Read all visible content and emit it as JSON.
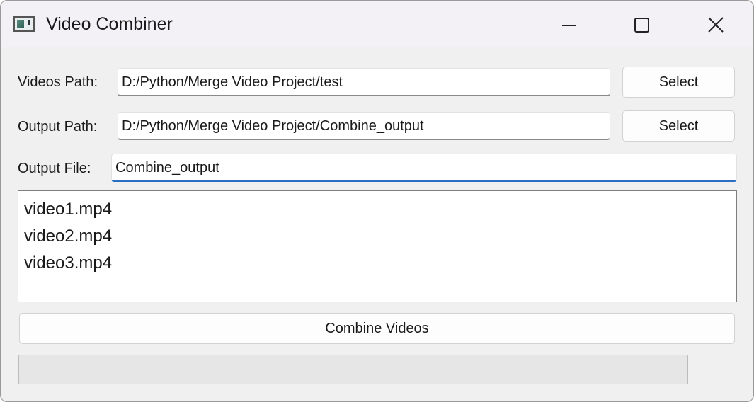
{
  "window": {
    "title": "Video Combiner",
    "app_icon": "app-window-icon",
    "controls": [
      "minimize-icon",
      "maximize-icon",
      "close-icon"
    ]
  },
  "form": {
    "videos_path_label": "Videos Path:",
    "videos_path_value": "D:/Python/Merge Video Project/test",
    "videos_select_label": "Select",
    "output_path_label": "Output Path:",
    "output_path_value": "D:/Python/Merge Video Project/Combine_output",
    "output_select_label": "Select",
    "output_file_label": "Output File:",
    "output_file_value": "Combine_output"
  },
  "video_list": {
    "items": [
      "video1.mp4",
      "video2.mp4",
      "video3.mp4"
    ]
  },
  "combine_button_label": "Combine Videos",
  "progress": {
    "value": 0
  }
}
